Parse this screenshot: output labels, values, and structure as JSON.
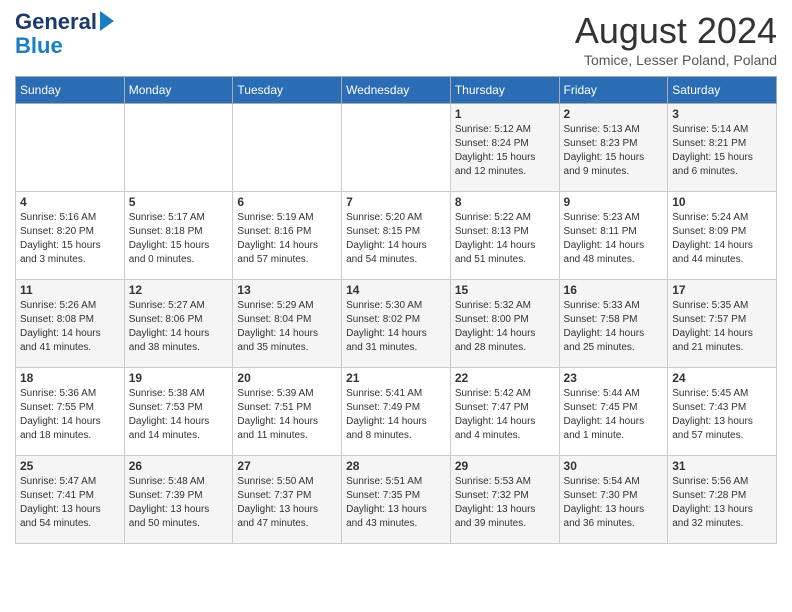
{
  "header": {
    "logo_line1": "General",
    "logo_line2": "Blue",
    "month_title": "August 2024",
    "location": "Tomice, Lesser Poland, Poland"
  },
  "days_of_week": [
    "Sunday",
    "Monday",
    "Tuesday",
    "Wednesday",
    "Thursday",
    "Friday",
    "Saturday"
  ],
  "weeks": [
    [
      {
        "day": "",
        "info": ""
      },
      {
        "day": "",
        "info": ""
      },
      {
        "day": "",
        "info": ""
      },
      {
        "day": "",
        "info": ""
      },
      {
        "day": "1",
        "info": "Sunrise: 5:12 AM\nSunset: 8:24 PM\nDaylight: 15 hours\nand 12 minutes."
      },
      {
        "day": "2",
        "info": "Sunrise: 5:13 AM\nSunset: 8:23 PM\nDaylight: 15 hours\nand 9 minutes."
      },
      {
        "day": "3",
        "info": "Sunrise: 5:14 AM\nSunset: 8:21 PM\nDaylight: 15 hours\nand 6 minutes."
      }
    ],
    [
      {
        "day": "4",
        "info": "Sunrise: 5:16 AM\nSunset: 8:20 PM\nDaylight: 15 hours\nand 3 minutes."
      },
      {
        "day": "5",
        "info": "Sunrise: 5:17 AM\nSunset: 8:18 PM\nDaylight: 15 hours\nand 0 minutes."
      },
      {
        "day": "6",
        "info": "Sunrise: 5:19 AM\nSunset: 8:16 PM\nDaylight: 14 hours\nand 57 minutes."
      },
      {
        "day": "7",
        "info": "Sunrise: 5:20 AM\nSunset: 8:15 PM\nDaylight: 14 hours\nand 54 minutes."
      },
      {
        "day": "8",
        "info": "Sunrise: 5:22 AM\nSunset: 8:13 PM\nDaylight: 14 hours\nand 51 minutes."
      },
      {
        "day": "9",
        "info": "Sunrise: 5:23 AM\nSunset: 8:11 PM\nDaylight: 14 hours\nand 48 minutes."
      },
      {
        "day": "10",
        "info": "Sunrise: 5:24 AM\nSunset: 8:09 PM\nDaylight: 14 hours\nand 44 minutes."
      }
    ],
    [
      {
        "day": "11",
        "info": "Sunrise: 5:26 AM\nSunset: 8:08 PM\nDaylight: 14 hours\nand 41 minutes."
      },
      {
        "day": "12",
        "info": "Sunrise: 5:27 AM\nSunset: 8:06 PM\nDaylight: 14 hours\nand 38 minutes."
      },
      {
        "day": "13",
        "info": "Sunrise: 5:29 AM\nSunset: 8:04 PM\nDaylight: 14 hours\nand 35 minutes."
      },
      {
        "day": "14",
        "info": "Sunrise: 5:30 AM\nSunset: 8:02 PM\nDaylight: 14 hours\nand 31 minutes."
      },
      {
        "day": "15",
        "info": "Sunrise: 5:32 AM\nSunset: 8:00 PM\nDaylight: 14 hours\nand 28 minutes."
      },
      {
        "day": "16",
        "info": "Sunrise: 5:33 AM\nSunset: 7:58 PM\nDaylight: 14 hours\nand 25 minutes."
      },
      {
        "day": "17",
        "info": "Sunrise: 5:35 AM\nSunset: 7:57 PM\nDaylight: 14 hours\nand 21 minutes."
      }
    ],
    [
      {
        "day": "18",
        "info": "Sunrise: 5:36 AM\nSunset: 7:55 PM\nDaylight: 14 hours\nand 18 minutes."
      },
      {
        "day": "19",
        "info": "Sunrise: 5:38 AM\nSunset: 7:53 PM\nDaylight: 14 hours\nand 14 minutes."
      },
      {
        "day": "20",
        "info": "Sunrise: 5:39 AM\nSunset: 7:51 PM\nDaylight: 14 hours\nand 11 minutes."
      },
      {
        "day": "21",
        "info": "Sunrise: 5:41 AM\nSunset: 7:49 PM\nDaylight: 14 hours\nand 8 minutes."
      },
      {
        "day": "22",
        "info": "Sunrise: 5:42 AM\nSunset: 7:47 PM\nDaylight: 14 hours\nand 4 minutes."
      },
      {
        "day": "23",
        "info": "Sunrise: 5:44 AM\nSunset: 7:45 PM\nDaylight: 14 hours\nand 1 minute."
      },
      {
        "day": "24",
        "info": "Sunrise: 5:45 AM\nSunset: 7:43 PM\nDaylight: 13 hours\nand 57 minutes."
      }
    ],
    [
      {
        "day": "25",
        "info": "Sunrise: 5:47 AM\nSunset: 7:41 PM\nDaylight: 13 hours\nand 54 minutes."
      },
      {
        "day": "26",
        "info": "Sunrise: 5:48 AM\nSunset: 7:39 PM\nDaylight: 13 hours\nand 50 minutes."
      },
      {
        "day": "27",
        "info": "Sunrise: 5:50 AM\nSunset: 7:37 PM\nDaylight: 13 hours\nand 47 minutes."
      },
      {
        "day": "28",
        "info": "Sunrise: 5:51 AM\nSunset: 7:35 PM\nDaylight: 13 hours\nand 43 minutes."
      },
      {
        "day": "29",
        "info": "Sunrise: 5:53 AM\nSunset: 7:32 PM\nDaylight: 13 hours\nand 39 minutes."
      },
      {
        "day": "30",
        "info": "Sunrise: 5:54 AM\nSunset: 7:30 PM\nDaylight: 13 hours\nand 36 minutes."
      },
      {
        "day": "31",
        "info": "Sunrise: 5:56 AM\nSunset: 7:28 PM\nDaylight: 13 hours\nand 32 minutes."
      }
    ]
  ]
}
